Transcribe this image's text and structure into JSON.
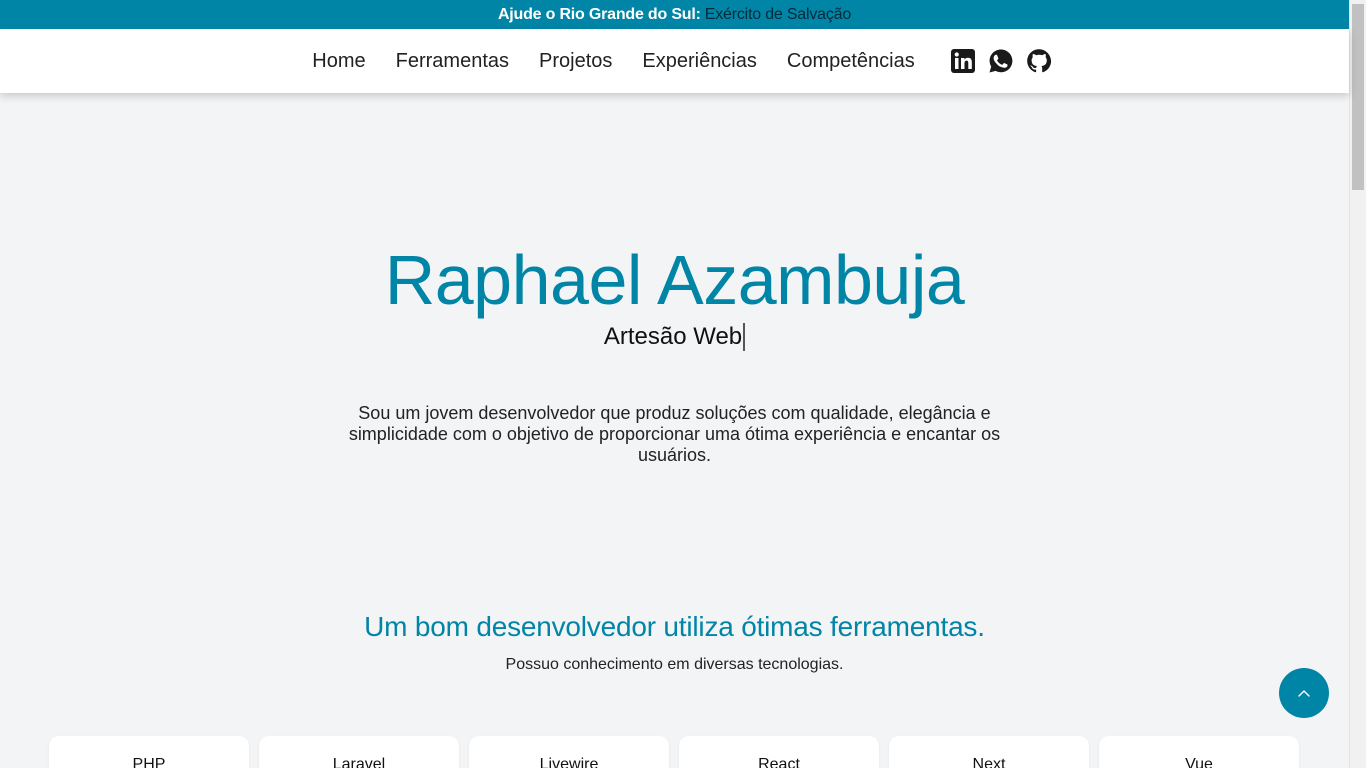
{
  "announcement": {
    "text": "Ajude o Rio Grande do Sul:",
    "link": "Exército de Salvação"
  },
  "nav": {
    "items": [
      {
        "label": "Home"
      },
      {
        "label": "Ferramentas"
      },
      {
        "label": "Projetos"
      },
      {
        "label": "Experiências"
      },
      {
        "label": "Competências"
      }
    ],
    "icons": [
      "linkedin-icon",
      "whatsapp-icon",
      "github-icon"
    ]
  },
  "hero": {
    "name": "Raphael Azambuja",
    "role": "Artesão Web",
    "description": "Sou um jovem desenvolvedor que produz soluções com qualidade, elegância e simplicidade com o objetivo de proporcionar uma ótima experiência e encantar os usuários."
  },
  "tools": {
    "title": "Um bom desenvolvedor utiliza ótimas ferramentas.",
    "subtitle": "Possuo conhecimento em diversas tecnologias.",
    "items": [
      {
        "label": "PHP"
      },
      {
        "label": "Laravel"
      },
      {
        "label": "Livewire"
      },
      {
        "label": "React"
      },
      {
        "label": "Next"
      },
      {
        "label": "Vue"
      }
    ]
  },
  "back_to_top": {
    "icon": "chevron-up-icon"
  },
  "colors": {
    "accent": "#0085a6",
    "background": "#f3f4f6",
    "link_dark": "#002b3a"
  }
}
